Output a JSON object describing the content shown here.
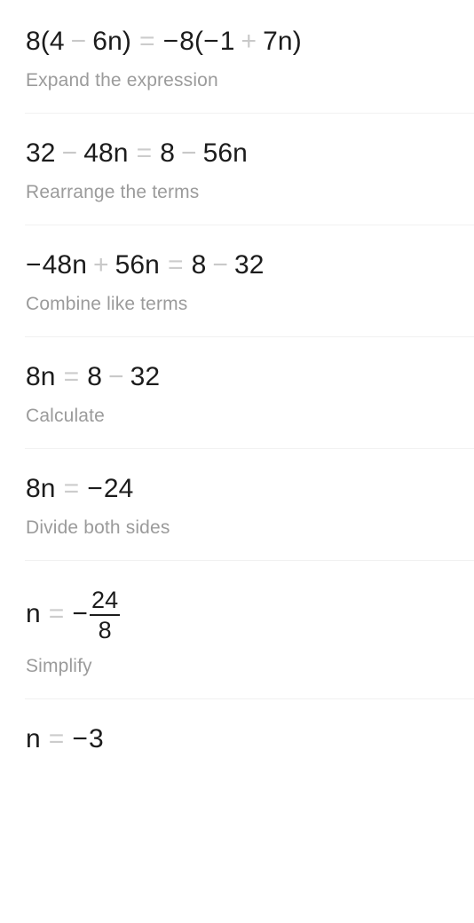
{
  "page": {
    "type": "math-step-by-step-solution",
    "background_color": "#ffffff",
    "equation_color": "#1c1c1c",
    "operator_color": "#c9c9c9",
    "caption_color": "#9b9b9b",
    "divider_color": "#f1f1f1"
  },
  "steps": [
    {
      "index": "1",
      "equation_text": "8(4 − 6n) = −8(−1 + 7n)",
      "parts": [
        {
          "type": "text",
          "value": "8(4"
        },
        {
          "type": "op",
          "value": "−"
        },
        {
          "type": "text",
          "value": "6n)"
        },
        {
          "type": "eq",
          "value": "="
        },
        {
          "type": "neg",
          "value": "−"
        },
        {
          "type": "text",
          "value": "8("
        },
        {
          "type": "neg",
          "value": "−"
        },
        {
          "type": "text",
          "value": "1"
        },
        {
          "type": "op",
          "value": "+"
        },
        {
          "type": "text",
          "value": "7n)"
        }
      ],
      "caption": "Expand the expression"
    },
    {
      "index": "2",
      "equation_text": "32 − 48n = 8 − 56n",
      "parts": [
        {
          "type": "text",
          "value": "32"
        },
        {
          "type": "op",
          "value": "−"
        },
        {
          "type": "text",
          "value": "48n"
        },
        {
          "type": "eq",
          "value": "="
        },
        {
          "type": "text",
          "value": "8"
        },
        {
          "type": "op",
          "value": "−"
        },
        {
          "type": "text",
          "value": "56n"
        }
      ],
      "caption": "Rearrange the terms"
    },
    {
      "index": "3",
      "equation_text": "−48n + 56n = 8 − 32",
      "parts": [
        {
          "type": "neg",
          "value": "−"
        },
        {
          "type": "text",
          "value": "48n"
        },
        {
          "type": "op",
          "value": "+"
        },
        {
          "type": "text",
          "value": "56n"
        },
        {
          "type": "eq",
          "value": "="
        },
        {
          "type": "text",
          "value": "8"
        },
        {
          "type": "op",
          "value": "−"
        },
        {
          "type": "text",
          "value": "32"
        }
      ],
      "caption": "Combine like terms"
    },
    {
      "index": "4",
      "equation_text": "8n = 8 − 32",
      "parts": [
        {
          "type": "text",
          "value": "8n"
        },
        {
          "type": "eq",
          "value": "="
        },
        {
          "type": "text",
          "value": "8"
        },
        {
          "type": "op",
          "value": "−"
        },
        {
          "type": "text",
          "value": "32"
        }
      ],
      "caption": "Calculate"
    },
    {
      "index": "5",
      "equation_text": "8n = −24",
      "parts": [
        {
          "type": "text",
          "value": "8n"
        },
        {
          "type": "eq",
          "value": "="
        },
        {
          "type": "neg",
          "value": "−"
        },
        {
          "type": "text",
          "value": "24"
        }
      ],
      "caption": "Divide both sides"
    },
    {
      "index": "6",
      "equation_text": "n = −24/8",
      "parts": [
        {
          "type": "text",
          "value": "n"
        },
        {
          "type": "eq",
          "value": "="
        },
        {
          "type": "neg",
          "value": "−"
        },
        {
          "type": "fraction",
          "numerator": "24",
          "denominator": "8"
        }
      ],
      "caption": "Simplify"
    },
    {
      "index": "7",
      "equation_text": "n = −3",
      "parts": [
        {
          "type": "text",
          "value": "n"
        },
        {
          "type": "eq",
          "value": "="
        },
        {
          "type": "neg",
          "value": "−"
        },
        {
          "type": "text",
          "value": "3"
        }
      ],
      "caption": ""
    }
  ]
}
